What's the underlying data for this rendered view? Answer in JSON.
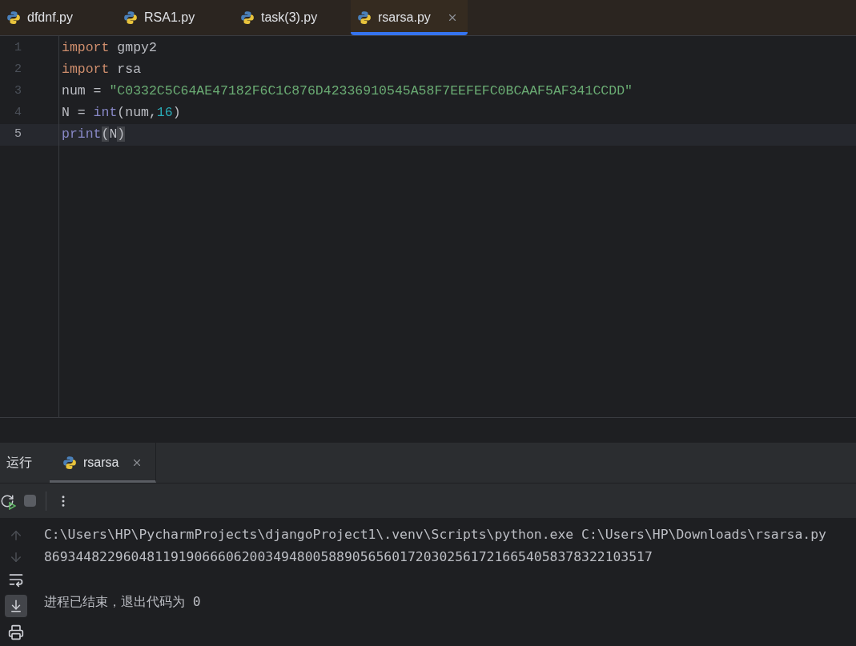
{
  "editor_tabs": [
    {
      "label": "dfdnf.py",
      "selected": false
    },
    {
      "label": "RSA1.py",
      "selected": false
    },
    {
      "label": "task(3).py",
      "selected": false
    },
    {
      "label": "rsarsa.py",
      "selected": true
    }
  ],
  "code": [
    {
      "number": "1",
      "current": false,
      "tokens": [
        {
          "kind": "keyword",
          "text": "import"
        },
        {
          "kind": "plain",
          "text": " gmpy2"
        }
      ]
    },
    {
      "number": "2",
      "current": false,
      "tokens": [
        {
          "kind": "keyword",
          "text": "import"
        },
        {
          "kind": "plain",
          "text": " rsa"
        }
      ]
    },
    {
      "number": "3",
      "current": false,
      "tokens": [
        {
          "kind": "plain",
          "text": "num = "
        },
        {
          "kind": "string",
          "text": "\"C0332C5C64AE47182F6C1C876D42336910545A58F7EEFEFC0BCAAF5AF341CCDD\""
        }
      ]
    },
    {
      "number": "4",
      "current": false,
      "tokens": [
        {
          "kind": "plain",
          "text": "N = "
        },
        {
          "kind": "builtin",
          "text": "int"
        },
        {
          "kind": "plain",
          "text": "(num,"
        },
        {
          "kind": "number",
          "text": "16"
        },
        {
          "kind": "plain",
          "text": ")"
        }
      ]
    },
    {
      "number": "5",
      "current": true,
      "tokens": [
        {
          "kind": "builtin",
          "text": "print"
        },
        {
          "kind": "brace",
          "text": "("
        },
        {
          "kind": "plain",
          "text": "N"
        },
        {
          "kind": "brace",
          "text": ")"
        }
      ]
    }
  ],
  "run_panel": {
    "title": "运行",
    "tabs": [
      {
        "label": "rsarsa",
        "selected": true
      }
    ],
    "output": [
      {
        "kind": "command",
        "text": "C:\\Users\\HP\\PycharmProjects\\djangoProject1\\.venv\\Scripts\\python.exe C:\\Users\\HP\\Downloads\\rsarsa.py"
      },
      {
        "kind": "stdout",
        "text": "86934482296048119190666062003494800588905656017203025617216654058378322103517"
      },
      {
        "kind": "exit",
        "text": "进程已结束，退出代码为 0"
      }
    ]
  }
}
